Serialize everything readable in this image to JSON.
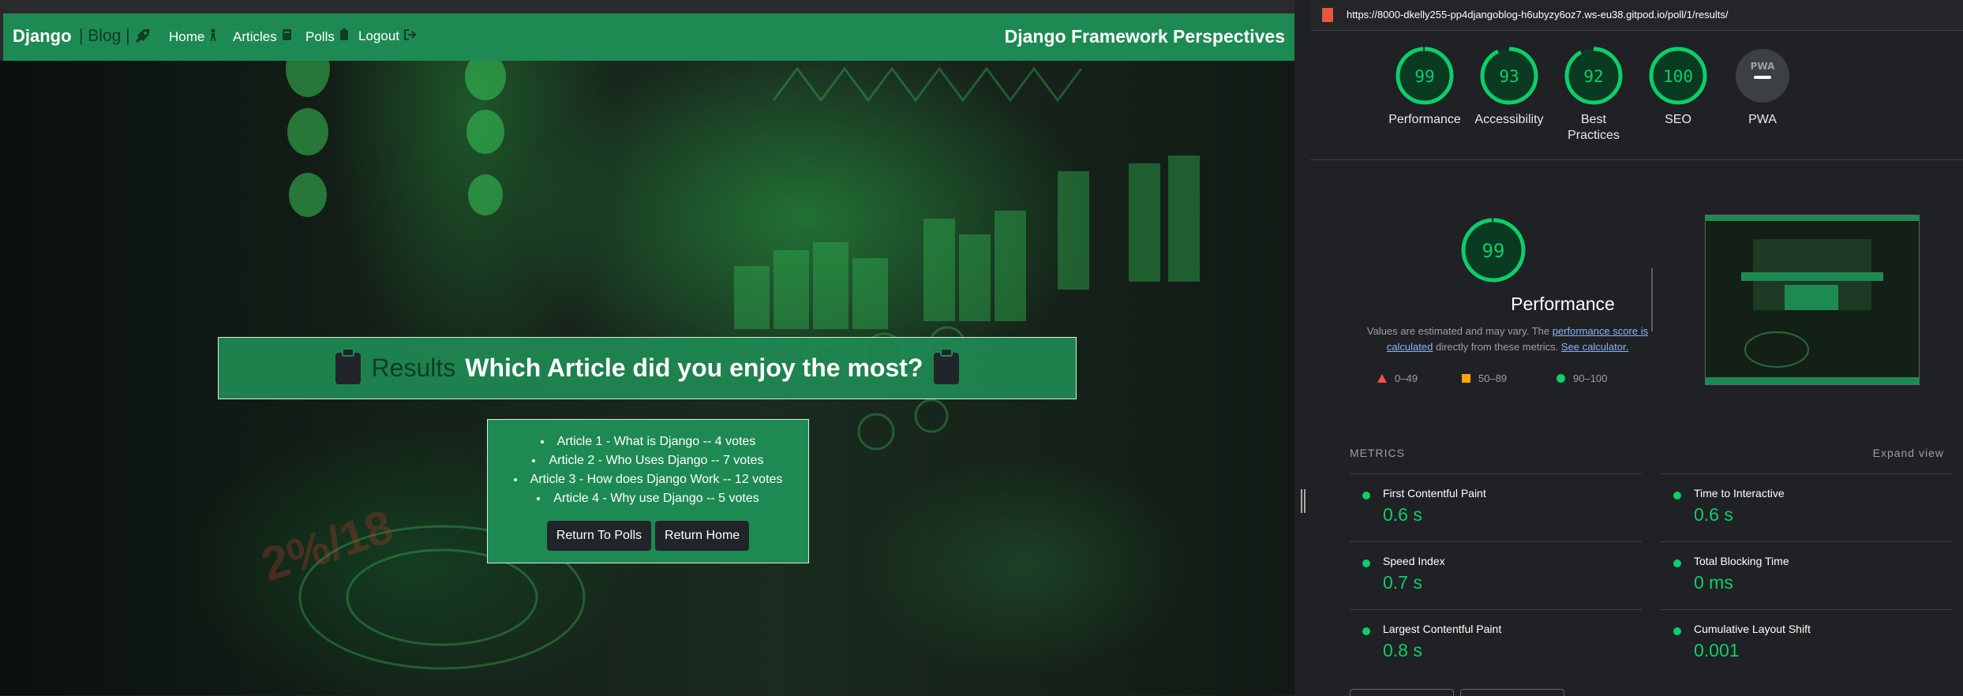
{
  "site": {
    "brand": "Django",
    "brand_sub": "| Blog |",
    "nav": [
      {
        "label": "Home",
        "icon": "person-icon"
      },
      {
        "label": "Articles",
        "icon": "book-icon"
      },
      {
        "label": "Polls",
        "icon": "clipboard-icon"
      },
      {
        "label": "Logout",
        "icon": "logout-icon"
      }
    ],
    "title": "Django Framework Perspectives",
    "colors": {
      "primary": "#1e8a53",
      "button": "#212529"
    },
    "results": {
      "label": "Results",
      "question": "Which Article did you enjoy the most?",
      "items": [
        "Article 1 - What is Django -- 4 votes",
        "Article 2 - Who Uses Django -- 7 votes",
        "Article 3 - How does Django Work -- 12 votes",
        "Article 4 - Why use Django -- 5 votes"
      ],
      "buttons": {
        "polls": "Return To Polls",
        "home": "Return Home"
      }
    }
  },
  "lighthouse": {
    "url": "https://8000-dkelly255-pp4djangoblog-h6ubyzy6oz7.ws-eu38.gitpod.io/poll/1/results/",
    "categories": [
      {
        "score": "99",
        "label": "Performance",
        "value": 0.99
      },
      {
        "score": "93",
        "label": "Accessibility",
        "value": 0.93
      },
      {
        "score": "92",
        "label": "Best Practices",
        "value": 0.92
      },
      {
        "score": "100",
        "label": "SEO",
        "value": 1.0
      },
      {
        "score": "PWA",
        "label": "PWA",
        "value": 0
      }
    ],
    "performance": {
      "score": "99",
      "title": "Performance",
      "note_prefix": "Values are estimated and may vary. The ",
      "note_link1": "performance score is calculated",
      "note_mid": " directly from these metrics. ",
      "note_link2": "See calculator.",
      "legend": [
        {
          "range": "0–49",
          "color": "#ff4e42"
        },
        {
          "range": "50–89",
          "color": "#ffa400"
        },
        {
          "range": "90–100",
          "color": "#0cce6b"
        }
      ]
    },
    "metrics_heading": "METRICS",
    "expand_label": "Expand view",
    "metrics": [
      {
        "name": "First Contentful Paint",
        "value": "0.6 s"
      },
      {
        "name": "Time to Interactive",
        "value": "0.6 s"
      },
      {
        "name": "Speed Index",
        "value": "0.7 s"
      },
      {
        "name": "Total Blocking Time",
        "value": "0 ms"
      },
      {
        "name": "Largest Contentful Paint",
        "value": "0.8 s"
      },
      {
        "name": "Cumulative Layout Shift",
        "value": "0.001"
      }
    ],
    "colors": {
      "pass": "#0cce6b",
      "pass_bg": "#0a3a22",
      "pwa_bg": "#3c4043"
    }
  }
}
